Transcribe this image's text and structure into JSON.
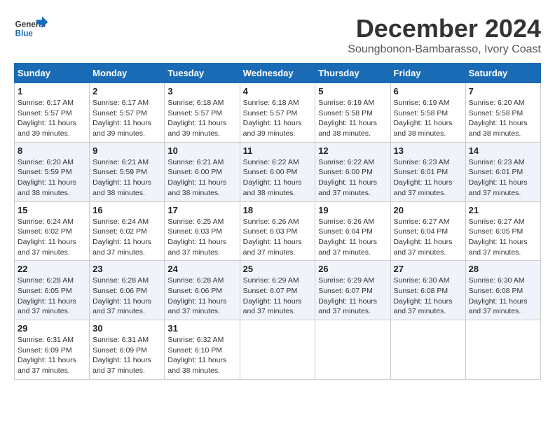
{
  "header": {
    "logo_line1": "General",
    "logo_line2": "Blue",
    "month": "December 2024",
    "location": "Soungbonon-Bambarasso, Ivory Coast"
  },
  "weekdays": [
    "Sunday",
    "Monday",
    "Tuesday",
    "Wednesday",
    "Thursday",
    "Friday",
    "Saturday"
  ],
  "weeks": [
    [
      {
        "day": "1",
        "sunrise": "6:17 AM",
        "sunset": "5:57 PM",
        "daylight": "11 hours and 39 minutes."
      },
      {
        "day": "2",
        "sunrise": "6:17 AM",
        "sunset": "5:57 PM",
        "daylight": "11 hours and 39 minutes."
      },
      {
        "day": "3",
        "sunrise": "6:18 AM",
        "sunset": "5:57 PM",
        "daylight": "11 hours and 39 minutes."
      },
      {
        "day": "4",
        "sunrise": "6:18 AM",
        "sunset": "5:57 PM",
        "daylight": "11 hours and 39 minutes."
      },
      {
        "day": "5",
        "sunrise": "6:19 AM",
        "sunset": "5:58 PM",
        "daylight": "11 hours and 38 minutes."
      },
      {
        "day": "6",
        "sunrise": "6:19 AM",
        "sunset": "5:58 PM",
        "daylight": "11 hours and 38 minutes."
      },
      {
        "day": "7",
        "sunrise": "6:20 AM",
        "sunset": "5:58 PM",
        "daylight": "11 hours and 38 minutes."
      }
    ],
    [
      {
        "day": "8",
        "sunrise": "6:20 AM",
        "sunset": "5:59 PM",
        "daylight": "11 hours and 38 minutes."
      },
      {
        "day": "9",
        "sunrise": "6:21 AM",
        "sunset": "5:59 PM",
        "daylight": "11 hours and 38 minutes."
      },
      {
        "day": "10",
        "sunrise": "6:21 AM",
        "sunset": "6:00 PM",
        "daylight": "11 hours and 38 minutes."
      },
      {
        "day": "11",
        "sunrise": "6:22 AM",
        "sunset": "6:00 PM",
        "daylight": "11 hours and 38 minutes."
      },
      {
        "day": "12",
        "sunrise": "6:22 AM",
        "sunset": "6:00 PM",
        "daylight": "11 hours and 37 minutes."
      },
      {
        "day": "13",
        "sunrise": "6:23 AM",
        "sunset": "6:01 PM",
        "daylight": "11 hours and 37 minutes."
      },
      {
        "day": "14",
        "sunrise": "6:23 AM",
        "sunset": "6:01 PM",
        "daylight": "11 hours and 37 minutes."
      }
    ],
    [
      {
        "day": "15",
        "sunrise": "6:24 AM",
        "sunset": "6:02 PM",
        "daylight": "11 hours and 37 minutes."
      },
      {
        "day": "16",
        "sunrise": "6:24 AM",
        "sunset": "6:02 PM",
        "daylight": "11 hours and 37 minutes."
      },
      {
        "day": "17",
        "sunrise": "6:25 AM",
        "sunset": "6:03 PM",
        "daylight": "11 hours and 37 minutes."
      },
      {
        "day": "18",
        "sunrise": "6:26 AM",
        "sunset": "6:03 PM",
        "daylight": "11 hours and 37 minutes."
      },
      {
        "day": "19",
        "sunrise": "6:26 AM",
        "sunset": "6:04 PM",
        "daylight": "11 hours and 37 minutes."
      },
      {
        "day": "20",
        "sunrise": "6:27 AM",
        "sunset": "6:04 PM",
        "daylight": "11 hours and 37 minutes."
      },
      {
        "day": "21",
        "sunrise": "6:27 AM",
        "sunset": "6:05 PM",
        "daylight": "11 hours and 37 minutes."
      }
    ],
    [
      {
        "day": "22",
        "sunrise": "6:28 AM",
        "sunset": "6:05 PM",
        "daylight": "11 hours and 37 minutes."
      },
      {
        "day": "23",
        "sunrise": "6:28 AM",
        "sunset": "6:06 PM",
        "daylight": "11 hours and 37 minutes."
      },
      {
        "day": "24",
        "sunrise": "6:28 AM",
        "sunset": "6:06 PM",
        "daylight": "11 hours and 37 minutes."
      },
      {
        "day": "25",
        "sunrise": "6:29 AM",
        "sunset": "6:07 PM",
        "daylight": "11 hours and 37 minutes."
      },
      {
        "day": "26",
        "sunrise": "6:29 AM",
        "sunset": "6:07 PM",
        "daylight": "11 hours and 37 minutes."
      },
      {
        "day": "27",
        "sunrise": "6:30 AM",
        "sunset": "6:08 PM",
        "daylight": "11 hours and 37 minutes."
      },
      {
        "day": "28",
        "sunrise": "6:30 AM",
        "sunset": "6:08 PM",
        "daylight": "11 hours and 37 minutes."
      }
    ],
    [
      {
        "day": "29",
        "sunrise": "6:31 AM",
        "sunset": "6:09 PM",
        "daylight": "11 hours and 37 minutes."
      },
      {
        "day": "30",
        "sunrise": "6:31 AM",
        "sunset": "6:09 PM",
        "daylight": "11 hours and 37 minutes."
      },
      {
        "day": "31",
        "sunrise": "6:32 AM",
        "sunset": "6:10 PM",
        "daylight": "11 hours and 38 minutes."
      },
      null,
      null,
      null,
      null
    ]
  ],
  "labels": {
    "sunrise": "Sunrise: ",
    "sunset": "Sunset: ",
    "daylight": "Daylight: "
  }
}
